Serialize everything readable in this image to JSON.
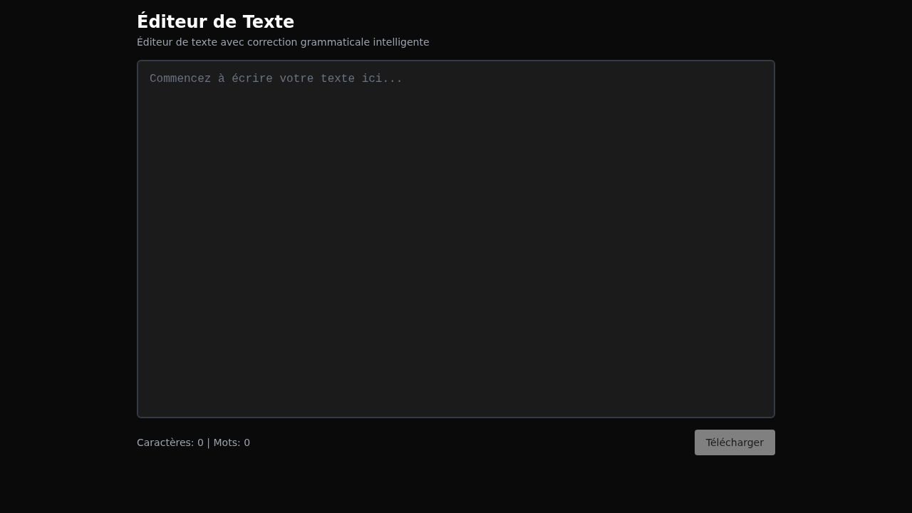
{
  "header": {
    "title": "Éditeur de Texte",
    "subtitle": "Éditeur de texte avec correction grammaticale intelligente"
  },
  "editor": {
    "placeholder": "Commencez à écrire votre texte ici..."
  },
  "footer": {
    "stats": "Caractères: 0 | Mots: 0",
    "download_button": {
      "label": "Télécharger",
      "disabled": true
    }
  }
}
